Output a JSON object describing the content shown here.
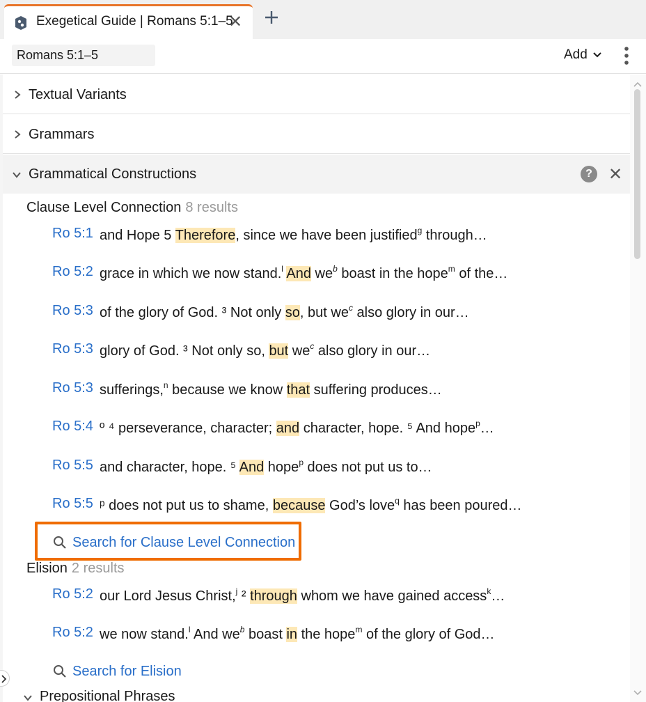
{
  "tab": {
    "title": "Exegetical Guide | Romans 5:1–5",
    "close": "✕"
  },
  "toolbar": {
    "reference": "Romans 5:1–5",
    "add_label": "Add"
  },
  "sections": {
    "textual_variants": "Textual Variants",
    "grammars": "Grammars",
    "grammatical_constructions": "Grammatical Constructions",
    "help": "?",
    "close": "✕",
    "prepositional_phrases": "Prepositional Phrases"
  },
  "clause_level": {
    "title": "Clause Level Connection",
    "count": "8 results",
    "search_label": "Search for Clause Level Connection",
    "results": [
      {
        "ref": "Ro 5:1",
        "pre": "and Hope 5 ",
        "hl": "Therefore",
        "post": ", since we have been justified",
        "sup": "g",
        "post2": " through…"
      },
      {
        "ref": "Ro 5:2",
        "pre": "grace in which we now stand.",
        "sup": "l",
        "pre2": " ",
        "hl": "And",
        "post": " we",
        "sup2": "b",
        "post2": " boast in the hope",
        "sup3": "m",
        "post3": " of the…"
      },
      {
        "ref": "Ro 5:3",
        "pre": "of the glory of God. ³ Not only ",
        "hl": "so",
        "post": ", but we",
        "sup": "c",
        "post2": " also glory in our…"
      },
      {
        "ref": "Ro 5:3",
        "pre": "glory of God. ³ Not only so, ",
        "hl": "but",
        "post": " we",
        "sup": "c",
        "post2": " also glory in our…"
      },
      {
        "ref": "Ro 5:3",
        "pre": "sufferings,",
        "sup": "n",
        "pre2": " because we know ",
        "hl": "that",
        "post": " suffering produces…"
      },
      {
        "ref": "Ro 5:4",
        "pre": "º ⁴ perseverance, character; ",
        "hl": "and",
        "post": " character, hope. ⁵ And hope",
        "sup": "p",
        "post2": "…"
      },
      {
        "ref": "Ro 5:5",
        "pre": "and character, hope. ⁵ ",
        "hl": "And",
        "post": " hope",
        "sup": "p",
        "post2": " does not put us to…"
      },
      {
        "ref": "Ro 5:5",
        "pre": "ᵖ does not put us to shame, ",
        "hl": "because",
        "post": " God’s love",
        "sup": "q",
        "post2": " has been poured…"
      }
    ]
  },
  "elision": {
    "title": "Elision",
    "count": "2 results",
    "search_label": "Search for Elision",
    "results": [
      {
        "ref": "Ro 5:2",
        "pre": "our Lord Jesus Christ,",
        "sup": "j",
        "pre2": " ² ",
        "hl": "through",
        "post": " whom we have gained access",
        "sup2": "k",
        "post2": "…"
      },
      {
        "ref": "Ro 5:2",
        "pre": "we now stand.",
        "sup": "l",
        "pre2": " And we",
        "sup2": "b",
        "pre3": " boast ",
        "hl": "in",
        "post": " the hope",
        "sup3": "m",
        "post2": " of the glory of God…"
      }
    ]
  },
  "colors": {
    "accent": "#e8752a",
    "link": "#2a6fc9",
    "highlight": "#fde8b6",
    "callout": "#ef6c00"
  }
}
